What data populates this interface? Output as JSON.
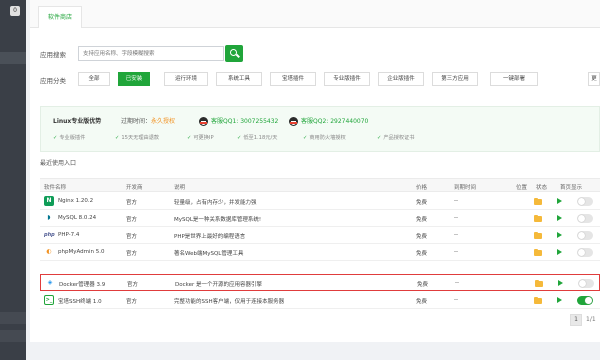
{
  "tabs": {
    "active": "软件商店"
  },
  "sidebar": {
    "badge": "0"
  },
  "search": {
    "label": "应用搜索",
    "placeholder": "支持应用名称、字段模糊搜索"
  },
  "categories": {
    "label": "应用分类",
    "items": [
      "全部",
      "已安装",
      "运行环境",
      "系统工具",
      "宝塔插件",
      "专业版插件",
      "企业版插件",
      "第三方应用",
      "一键部署",
      "更"
    ]
  },
  "promo": {
    "title": "Linux专业版优势",
    "expire_label": "过期时间：",
    "expire_value": "永久授权",
    "qq1": "客服QQ1: 3007255432",
    "qq2": "客服QQ2: 2927440070",
    "features": [
      "专业版插件",
      "15天无理由退款",
      "可更换IP",
      "低至1.18元/天",
      "商用防火墙授权",
      "产品授权证书"
    ]
  },
  "recent": {
    "label": "最近使用入口"
  },
  "table": {
    "headers": [
      "软件名称",
      "开发商",
      "说明",
      "价格",
      "到期时间",
      "位置",
      "状态",
      "首页显示"
    ],
    "rows": [
      {
        "name": "Nginx 1.20.2",
        "vendor": "官方",
        "desc": "轻量级，占有内存少，并发能力强",
        "price": "免费",
        "expire": "--",
        "icon": "nginx-icon",
        "toggle": false
      },
      {
        "name": "MySQL 8.0.24",
        "vendor": "官方",
        "desc": "MySQL是一种关系数据库管理系统!",
        "price": "免费",
        "expire": "--",
        "icon": "mysql-icon",
        "toggle": false
      },
      {
        "name": "PHP-7.4",
        "vendor": "官方",
        "desc": "PHP是世界上最好的编程语言",
        "price": "免费",
        "expire": "--",
        "icon": "php-icon",
        "toggle": false
      },
      {
        "name": "phpMyAdmin 5.0",
        "vendor": "官方",
        "desc": "著名Web端MySQL管理工具",
        "price": "免费",
        "expire": "--",
        "icon": "phpmyadmin-icon",
        "toggle": false
      },
      {
        "name": "Docker管理器 3.9",
        "vendor": "官方",
        "desc": "Docker 是一个开源的应用容器引擎",
        "price": "免费",
        "expire": "--",
        "icon": "docker-icon",
        "toggle": false
      },
      {
        "name": "宝塔SSH终端 1.0",
        "vendor": "官方",
        "desc": "完整功能的SSH客户端，仅用于连接本服务器",
        "price": "免费",
        "expire": "--",
        "icon": "terminal-icon",
        "toggle": true
      }
    ]
  },
  "pager": {
    "current": "1",
    "total": "1/1"
  },
  "colors": {
    "accent": "#20a53a",
    "highlight": "#e03c3c",
    "sidebar": "#3a3f47"
  }
}
